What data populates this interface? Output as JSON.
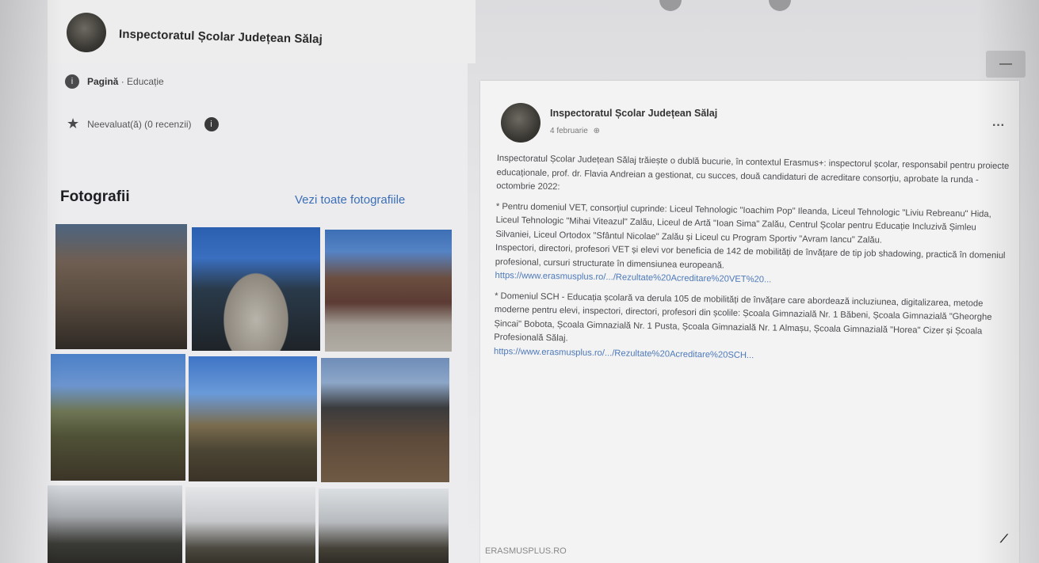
{
  "page": {
    "name": "Inspectoratul Școlar Județean Sălaj",
    "category_label": "Pagină",
    "category_value": "Educație",
    "reviews_text": "Neevaluat(ă) (0 recenzii)",
    "reviews_badge": "i"
  },
  "photos": {
    "title": "Fotografii",
    "see_all": "Vezi toate fotografiile"
  },
  "post": {
    "author": "Inspectoratul Școlar Județean Sălaj",
    "date": "4 februarie",
    "privacy_icon": "globe-icon",
    "more_label": "···",
    "paragraph_1": "Inspectoratul Școlar Județean Sălaj trăiește o dublă bucurie, în contextul Erasmus+: inspectorul școlar, responsabil pentru proiecte educaționale, prof. dr. Flavia Andreian a gestionat, cu succes, două candidaturi de acreditare consorțiu, aprobate la runda - octombrie 2022:",
    "paragraph_2": "* Pentru domeniul VET, consorțiul cuprinde: Liceul Tehnologic \"Ioachim Pop\" Ileanda, Liceul Tehnologic \"Liviu Rebreanu\" Hida, Liceul Tehnologic \"Mihai Viteazul\" Zalău, Liceul de Artă \"Ioan Sima\" Zalău, Centrul Școlar pentru Educație Incluzivă Șimleu Silvaniei, Liceul Ortodox \"Sfântul Nicolae\" Zalău și Liceul cu Program Sportiv \"Avram Iancu\" Zalău.",
    "paragraph_3": "Inspectori, directori, profesori VET și elevi vor beneficia de 142 de mobilități de învățare de tip job shadowing, practică în domeniul profesional, cursuri structurate în dimensiunea europeană.",
    "link_1": "https://www.erasmusplus.ro/.../Rezultate%20Acreditare%20VET%20...",
    "paragraph_4": "* Domeniul SCH - Educația școlară va derula 105 de mobilități de învățare care abordează incluziunea, digitalizarea, metode moderne pentru elevi, inspectori, directori, profesori din școlile: Școala Gimnazială Nr. 1 Băbeni, Școala Gimnazială \"Gheorghe Șincai\" Bobota, Școala Gimnazială Nr. 1 Pusta, Școala Gimnazială Nr. 1 Almașu, Școala Gimnazială \"Horea\" Cizer și Școala Profesională Sălaj.",
    "link_2": "https://www.erasmusplus.ro/.../Rezultate%20Acreditare%20SCH...",
    "footer": "ERASMUSPLUS.RO"
  },
  "colors": {
    "link": "#3b6fb6",
    "card": "#f3f3f4"
  }
}
